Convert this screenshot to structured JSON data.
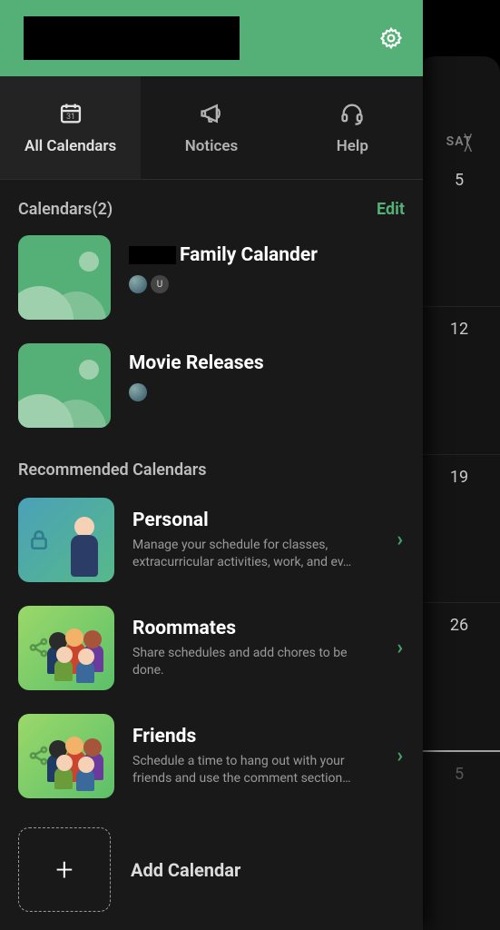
{
  "header": {
    "settings_icon": "gear-icon"
  },
  "tabs": [
    {
      "label": "All Calendars",
      "icon": "calendar-icon",
      "active": true
    },
    {
      "label": "Notices",
      "icon": "megaphone-icon",
      "active": false
    },
    {
      "label": "Help",
      "icon": "headset-icon",
      "active": false
    }
  ],
  "calendars_section": {
    "title": "Calendars(2)",
    "edit_label": "Edit"
  },
  "calendars": [
    {
      "name": "Family Calander",
      "has_masked_prefix": true,
      "avatars": [
        "img",
        "U"
      ]
    },
    {
      "name": "Movie Releases",
      "has_masked_prefix": false,
      "avatars": [
        "img"
      ]
    }
  ],
  "recommended_title": "Recommended Calendars",
  "recommended": [
    {
      "name": "Personal",
      "desc": "Manage your schedule for classes, extracurricular activities, work, and ev…",
      "kind": "personal"
    },
    {
      "name": "Roommates",
      "desc": "Share schedules and add chores to be done.",
      "kind": "group"
    },
    {
      "name": "Friends",
      "desc": "Schedule a time to hang out with your friends and use the comment section…",
      "kind": "group"
    }
  ],
  "add_calendar_label": "Add Calendar",
  "bg_calendar": {
    "day_head": "SAT",
    "dates": [
      "5",
      "12",
      "19",
      "26",
      "5"
    ]
  }
}
